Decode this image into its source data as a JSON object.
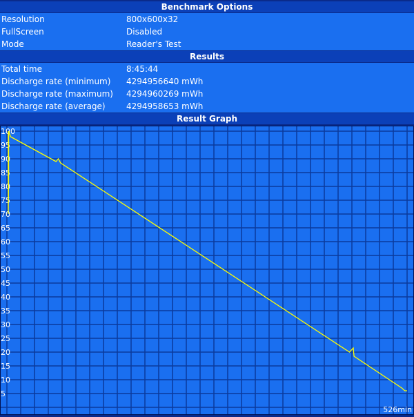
{
  "options": {
    "title": "Benchmark Options",
    "rows": [
      {
        "label": "Resolution",
        "value": "800x600x32"
      },
      {
        "label": "FullScreen",
        "value": "Disabled"
      },
      {
        "label": "Mode",
        "value": "Reader's Test"
      }
    ]
  },
  "results": {
    "title": "Results",
    "rows": [
      {
        "label": "Total time",
        "value": "8:45:44"
      },
      {
        "label": "Discharge rate (minimum)",
        "value": "4294956640 mWh"
      },
      {
        "label": "Discharge rate (maximum)",
        "value": "4294960269 mWh"
      },
      {
        "label": "Discharge rate (average)",
        "value": "4294958653 mWh"
      }
    ]
  },
  "graph_title": "Result Graph",
  "chart_data": {
    "type": "line",
    "ylim": [
      0,
      100
    ],
    "xlim": [
      0,
      526
    ],
    "yticks": [
      "100",
      "95",
      "90",
      "85",
      "80",
      "75",
      "70",
      "65",
      "60",
      "55",
      "50",
      "45",
      "40",
      "35",
      "30",
      "25",
      "20",
      "15",
      "10",
      "5"
    ],
    "xlabel_end": "526min",
    "grid": true,
    "line_color": "#ffff00",
    "points": [
      [
        0,
        100
      ],
      [
        0,
        70
      ],
      [
        0.5,
        85
      ],
      [
        0.5,
        100
      ],
      [
        3,
        98
      ],
      [
        63,
        89
      ],
      [
        66,
        90
      ],
      [
        69,
        88.5
      ],
      [
        450,
        20
      ],
      [
        455,
        21.5
      ],
      [
        456,
        18.5
      ],
      [
        519,
        7
      ],
      [
        523,
        6
      ],
      [
        526,
        6
      ]
    ]
  }
}
